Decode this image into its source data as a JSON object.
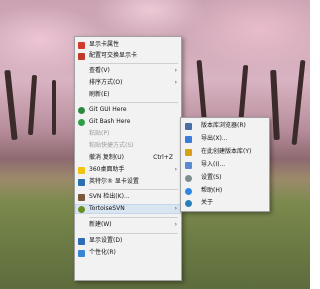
{
  "context_menu": {
    "items": [
      {
        "label": "显示卡属性",
        "icon": "display-card-icon"
      },
      {
        "label": "配置可交换显示卡",
        "icon": "switchable-graphics-icon"
      },
      {
        "label": "查看(V)",
        "submenu": "›"
      },
      {
        "label": "排序方式(O)",
        "submenu": "›"
      },
      {
        "label": "刷新(E)"
      },
      {
        "label": "Git GUI Here",
        "icon": "git-gui-icon"
      },
      {
        "label": "Git Bash Here",
        "icon": "git-bash-icon"
      },
      {
        "label": "粘贴(P)",
        "disabled": true
      },
      {
        "label": "粘贴快捷方式(S)",
        "disabled": true
      },
      {
        "label": "撤消 复制(U)",
        "shortcut": "Ctrl+Z"
      },
      {
        "label": "360桌面助手",
        "icon": "360-desktop-icon",
        "submenu": "›"
      },
      {
        "label": "英特尔® 显卡设置",
        "icon": "intel-graphics-icon"
      },
      {
        "label": "SVN 检出(K)...",
        "icon": "svn-checkout-icon"
      },
      {
        "label": "TortoiseSVN",
        "icon": "tortoisesvn-icon",
        "submenu": "›"
      },
      {
        "label": "新建(W)",
        "submenu": "›"
      },
      {
        "label": "显示设置(D)",
        "icon": "display-settings-icon"
      },
      {
        "label": "个性化(R)",
        "icon": "personalize-icon"
      }
    ]
  },
  "tortoise_submenu": {
    "items": [
      {
        "label": "版本库浏览器(R)",
        "icon": "repo-browser-icon"
      },
      {
        "label": "导出(X)...",
        "icon": "export-icon"
      },
      {
        "label": "在此创建版本库(Y)",
        "icon": "create-repo-icon"
      },
      {
        "label": "导入(I)...",
        "icon": "import-icon"
      },
      {
        "label": "设置(S)",
        "icon": "settings-icon"
      },
      {
        "label": "帮助(H)",
        "icon": "help-icon"
      },
      {
        "label": "关于",
        "icon": "about-icon"
      }
    ]
  }
}
